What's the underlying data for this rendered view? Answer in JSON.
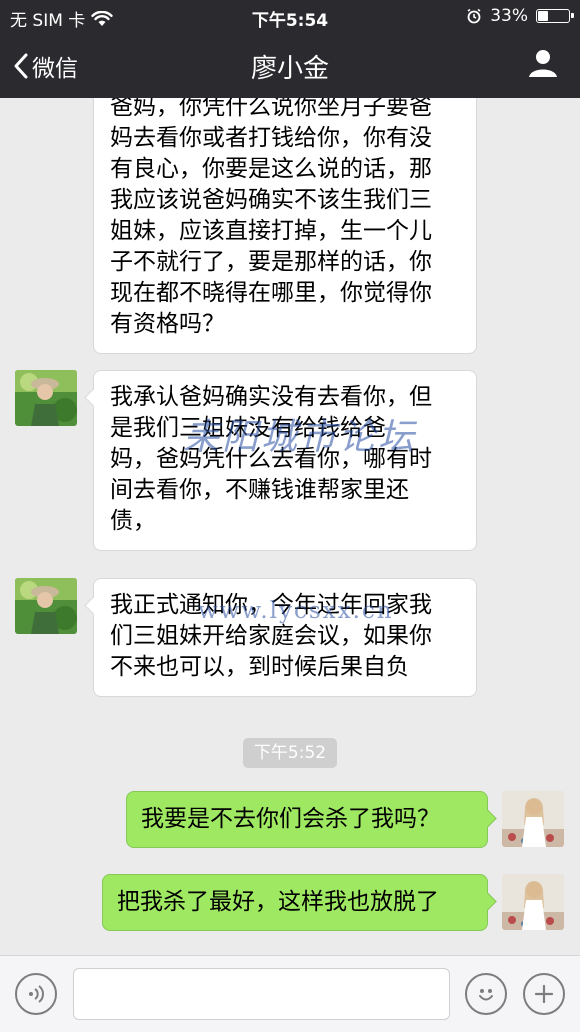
{
  "status_bar": {
    "carrier": "无 SIM 卡",
    "time": "下午5:54",
    "battery_percent": "33%",
    "battery_level": 0.33
  },
  "nav": {
    "back_label": "微信",
    "title": "廖小金"
  },
  "messages": [
    {
      "side": "left",
      "lines": [
        "爸妈，你凭什么说你坐月子要爸",
        "妈去看你或者打钱给你，你有没",
        "有良心，你要是这么说的话，那",
        "我应该说爸妈确实不该生我们三",
        "姐妹，应该直接打掉，生一个儿",
        "子不就行了，要是那样的话，你",
        "现在都不晓得在哪里，你觉得你",
        "有资格吗？"
      ]
    },
    {
      "side": "left",
      "lines": [
        "我承认爸妈确实没有去看你，但",
        "是我们三姐妹没有给钱给爸",
        "妈，爸妈凭什么去看你，哪有时",
        "间去看你，不赚钱谁帮家里还",
        "债，"
      ]
    },
    {
      "side": "left",
      "lines": [
        "我正式通知你，今年过年回家我",
        "们三姐妹开给家庭会议，如果你",
        "不来也可以，到时候后果自负"
      ]
    },
    {
      "side": "right",
      "lines": [
        "我要是不去你们会杀了我吗？"
      ]
    },
    {
      "side": "right",
      "lines": [
        "把我杀了最好，这样我也放脱了"
      ]
    }
  ],
  "timestamp": "下午5:52",
  "watermark": {
    "text": "耒阳城市论坛",
    "url": "www.lycsxx.cn"
  },
  "colors": {
    "nav_bg": "#2b2b2f",
    "chat_bg": "#ebebeb",
    "sent_bubble": "#9ee862",
    "received_bubble": "#ffffff"
  }
}
